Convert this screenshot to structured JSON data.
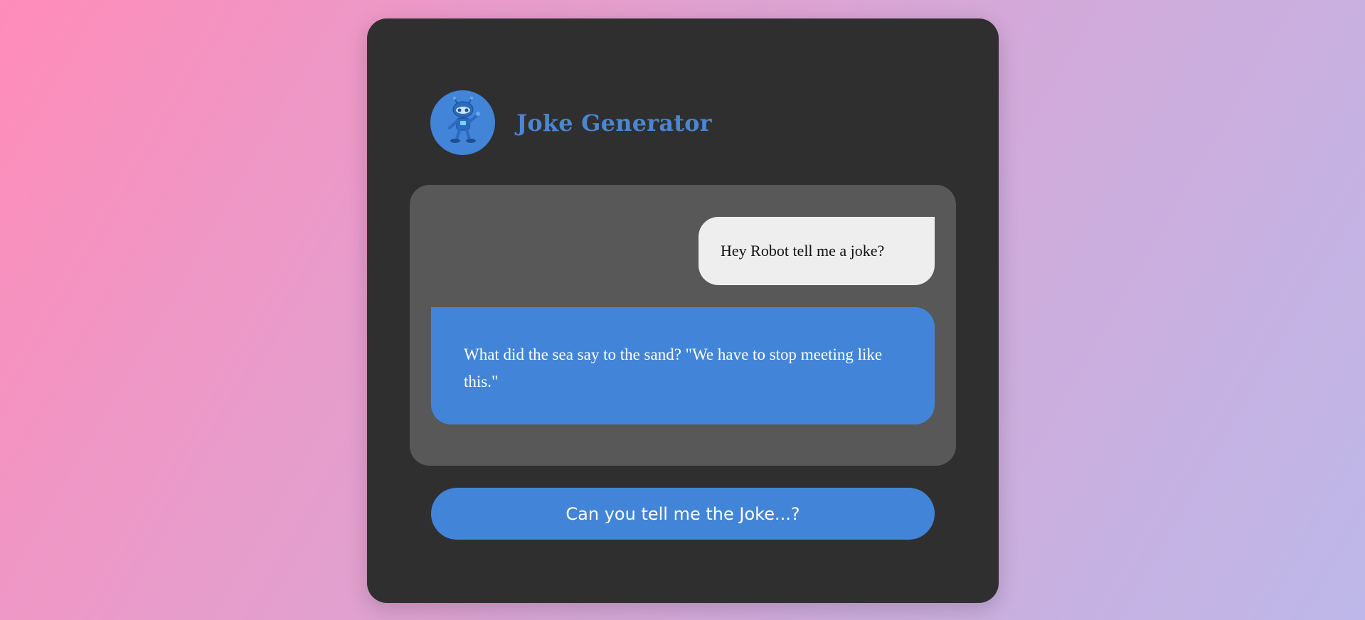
{
  "app": {
    "title": "Joke Generator",
    "avatar_icon": "robot-icon"
  },
  "chat": {
    "user_message": "Hey Robot tell me a joke?",
    "bot_message": "What did the sea say to the sand? \"We have to stop meeting like this.\""
  },
  "actions": {
    "button_label": "Can you tell me the Joke...?"
  },
  "colors": {
    "accent": "#4285d8",
    "card": "#2f2f2f",
    "chat_panel": "#585858",
    "user_bubble": "#eeeeee"
  }
}
